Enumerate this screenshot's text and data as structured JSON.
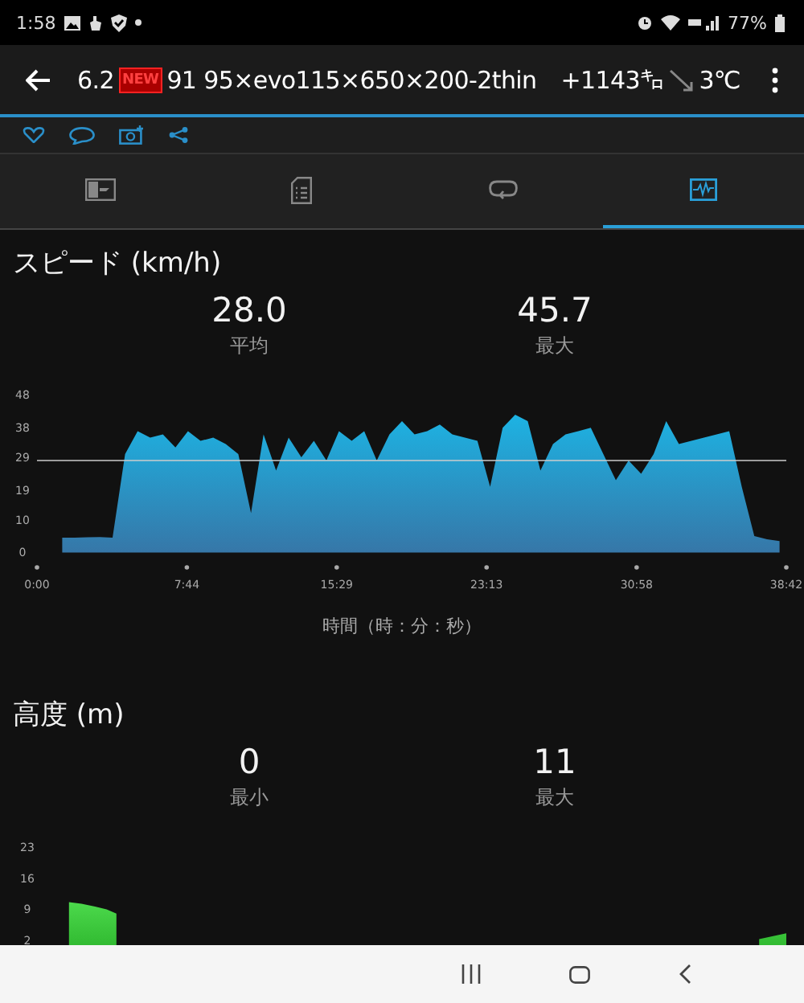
{
  "status_bar": {
    "time": "1:58",
    "battery": "77%"
  },
  "app_bar": {
    "title": "6.2",
    "badge": "NEW",
    "name": "91 95×evo115×650×200-2thin",
    "calories": "+1143㌔",
    "temperature": "3℃"
  },
  "tabs": [
    {
      "kind": "image",
      "selected": false
    },
    {
      "kind": "document",
      "selected": false
    },
    {
      "kind": "loop",
      "selected": false
    },
    {
      "kind": "chart",
      "selected": true
    }
  ],
  "speed": {
    "title": "スピード (km/h)",
    "stats": [
      {
        "value": "28.0",
        "label": "平均"
      },
      {
        "value": "45.7",
        "label": "最大"
      }
    ],
    "chart_data": {
      "type": "area",
      "xlabel": "時間（時：分：秒）",
      "xlim": [
        0,
        38.7
      ],
      "ylim": [
        0,
        48
      ],
      "xticks": [
        {
          "value": 0,
          "label": "0:00"
        },
        {
          "value": 7.74,
          "label": "7:44"
        },
        {
          "value": 15.48,
          "label": "15:29"
        },
        {
          "value": 23.22,
          "label": "23:13"
        },
        {
          "value": 30.97,
          "label": "30:58"
        },
        {
          "value": 38.7,
          "label": "38:42"
        }
      ],
      "yticks": [
        0,
        10,
        19,
        29,
        38,
        48
      ],
      "x": [
        1.3,
        1.95,
        2.6,
        3.25,
        3.9,
        4.55,
        5.2,
        5.85,
        6.5,
        7.15,
        7.8,
        8.45,
        9.1,
        9.75,
        10.4,
        11.05,
        11.7,
        12.35,
        13,
        13.65,
        14.3,
        14.95,
        15.6,
        16.25,
        16.9,
        17.55,
        18.2,
        18.85,
        19.5,
        20.15,
        20.8,
        21.45,
        22.1,
        22.75,
        23.4,
        24.05,
        24.7,
        25.35,
        26,
        26.65,
        27.3,
        27.95,
        28.6,
        29.25,
        29.9,
        30.55,
        31.2,
        31.85,
        32.5,
        33.15,
        33.8,
        34.45,
        35.1,
        35.75,
        36.4,
        37.05,
        37.7,
        38.35
      ],
      "series": [
        {
          "color": "#1db3e3",
          "values": [
            4.5,
            4.5,
            4.6,
            4.7,
            4.5,
            30,
            37,
            35,
            36,
            32,
            37,
            34,
            35,
            33,
            30,
            12,
            36,
            25,
            35,
            29,
            34,
            28,
            37,
            34,
            37,
            28,
            36,
            40,
            36,
            37,
            39,
            36,
            35,
            34,
            20,
            38,
            42,
            40,
            25,
            33,
            36,
            37,
            38,
            30,
            22,
            28,
            24,
            30,
            40,
            33,
            34,
            35,
            36,
            37,
            20,
            5,
            4,
            3.5
          ]
        }
      ]
    }
  },
  "altitude": {
    "title": "高度 (m)",
    "stats": [
      {
        "value": "0",
        "label": "最小"
      },
      {
        "value": "11",
        "label": "最大"
      }
    ],
    "chart_data": {
      "type": "area",
      "xlim": [
        0,
        38.7
      ],
      "ylim": [
        0,
        23
      ],
      "yticks": [
        2,
        9,
        16,
        23
      ],
      "x": [
        1.65,
        2.3,
        3.0,
        3.6,
        4.1,
        37.3,
        38.7
      ],
      "series": [
        {
          "color": "#4cd94c",
          "values": [
            10.6,
            10.2,
            9.6,
            9.0,
            8.0,
            2.3,
            3.6
          ]
        }
      ]
    }
  }
}
